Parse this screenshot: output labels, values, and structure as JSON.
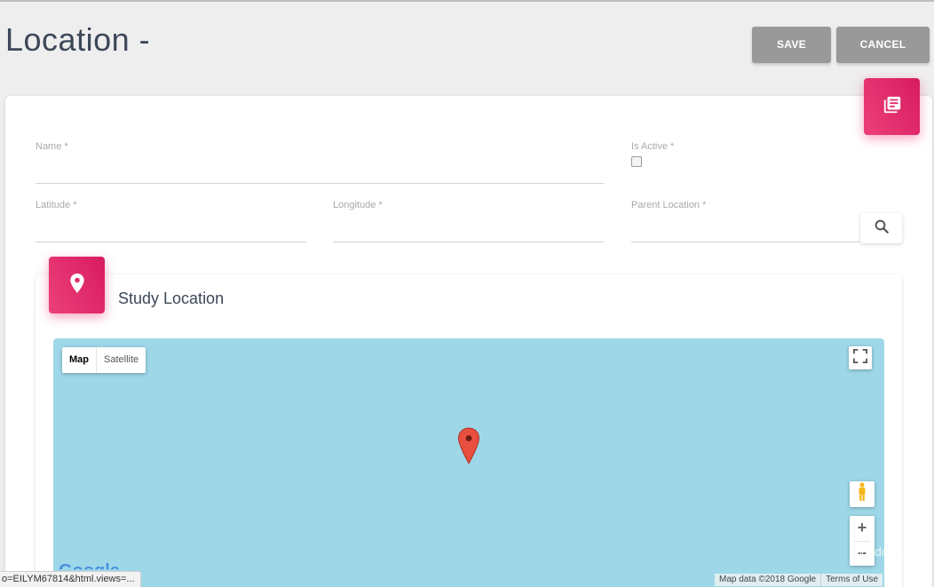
{
  "page": {
    "title": "Location -"
  },
  "toolbar": {
    "save_label": "SAVE",
    "cancel_label": "CANCEL"
  },
  "form": {
    "name_label": "Name *",
    "is_active_label": "Is Active *",
    "is_active_checked": false,
    "latitude_label": "Latitude *",
    "longitude_label": "Longitude *",
    "parent_location_label": "Parent Location *",
    "name_value": "",
    "latitude_value": "",
    "longitude_value": "",
    "parent_location_value": ""
  },
  "study_section": {
    "title": "Study Location"
  },
  "map": {
    "type_map_label": "Map",
    "type_satellite_label": "Satellite",
    "zoom_in": "+",
    "zoom_out": "−",
    "data_attribution": "Map data ©2018 Google",
    "terms": "Terms of Use",
    "logo_text": "Google",
    "water_color": "#9ed8e8",
    "marker_color": "#e94f3f"
  },
  "overlay": {
    "windows_watermark": "Windows.",
    "status_url": "o=EILYM67814&html.views=..."
  },
  "colors": {
    "accent": "#e91e63",
    "button_grey": "#999999"
  }
}
